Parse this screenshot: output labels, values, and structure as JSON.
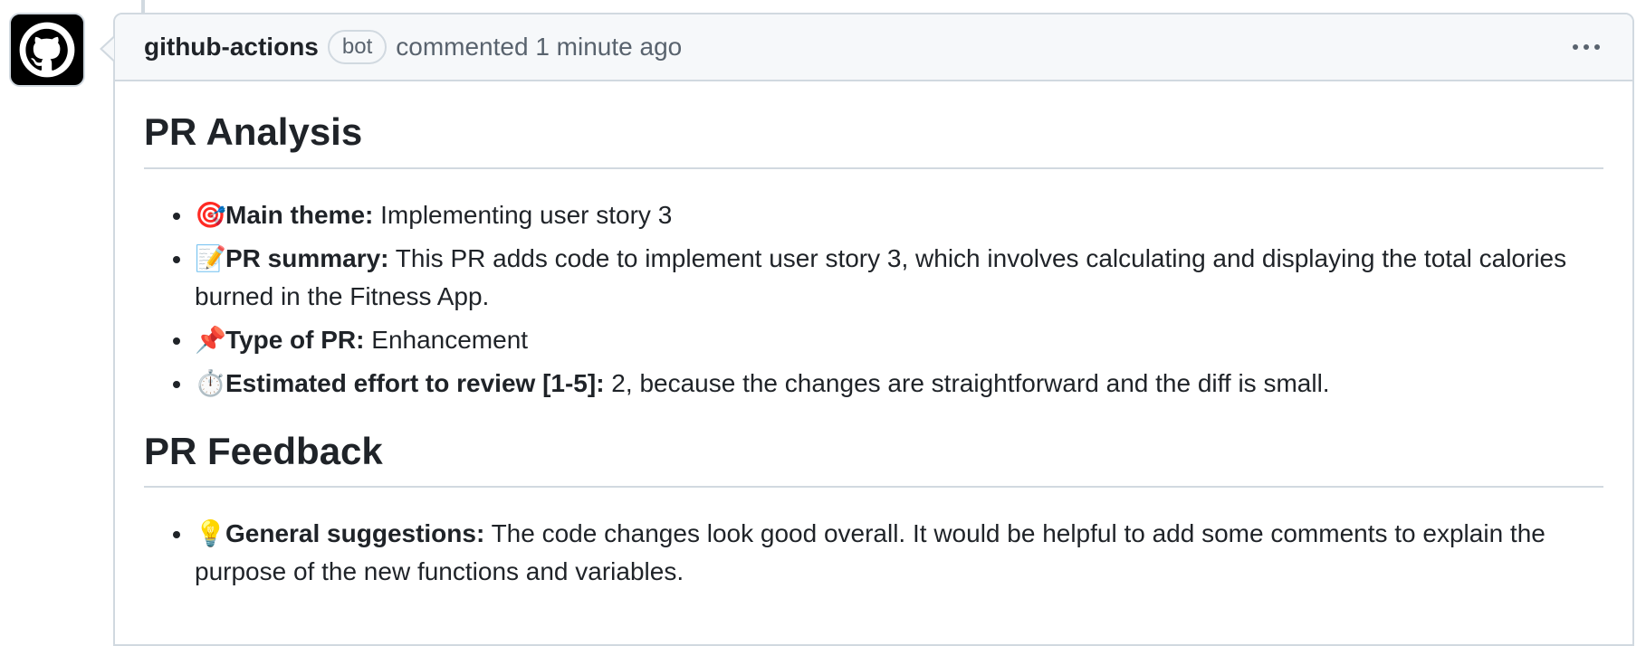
{
  "comment": {
    "author": "github-actions",
    "badge": "bot",
    "timestamp": "commented 1 minute ago",
    "more_icon": "kebab-horizontal-icon",
    "avatar_icon": "github-octocat-icon"
  },
  "sections": [
    {
      "title": "PR Analysis",
      "items": [
        {
          "emoji": "🎯",
          "label": "Main theme:",
          "text": " Implementing user story 3"
        },
        {
          "emoji": "📝",
          "label": "PR summary:",
          "text": " This PR adds code to implement user story 3, which involves calculating and displaying the total calories burned in the Fitness App."
        },
        {
          "emoji": "📌",
          "label": "Type of PR:",
          "text": " Enhancement"
        },
        {
          "emoji": "⏱️",
          "label": "Estimated effort to review [1-5]:",
          "text": " 2, because the changes are straightforward and the diff is small."
        }
      ]
    },
    {
      "title": "PR Feedback",
      "items": [
        {
          "emoji": "💡",
          "label": "General suggestions:",
          "text": " The code changes look good overall. It would be helpful to add some comments to explain the purpose of the new functions and variables."
        }
      ]
    }
  ],
  "colors": {
    "border": "#d1d9e0",
    "header_bg": "#f6f8fa",
    "muted": "#59636e",
    "text": "#1f2328"
  }
}
